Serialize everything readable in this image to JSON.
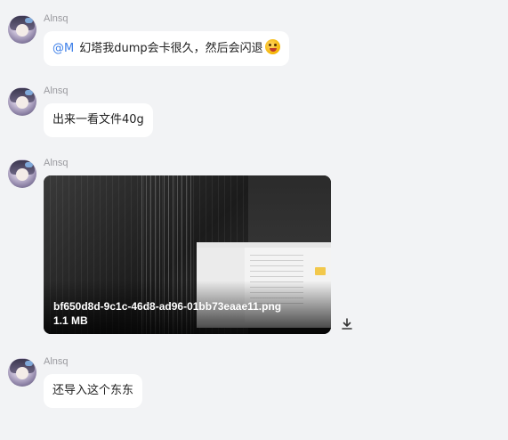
{
  "messages": [
    {
      "sender": "Alnsq",
      "mention": "@M",
      "text": "幻塔我dump会卡很久，然后会闪退",
      "emoji": "laughing-face-emoji"
    },
    {
      "sender": "Alnsq",
      "text": "出来一看文件40g"
    },
    {
      "sender": "Alnsq",
      "attachment": {
        "filename": "bf650d8d-9c1c-46d8-ad96-01bb73eaae11.png",
        "size": "1.1 MB"
      }
    },
    {
      "sender": "Alnsq",
      "text": "还导入这个东东"
    }
  ],
  "colors": {
    "background": "#f2f3f5",
    "bubble": "#ffffff",
    "mention": "#3d7fe8",
    "name": "#9a9a9f"
  }
}
